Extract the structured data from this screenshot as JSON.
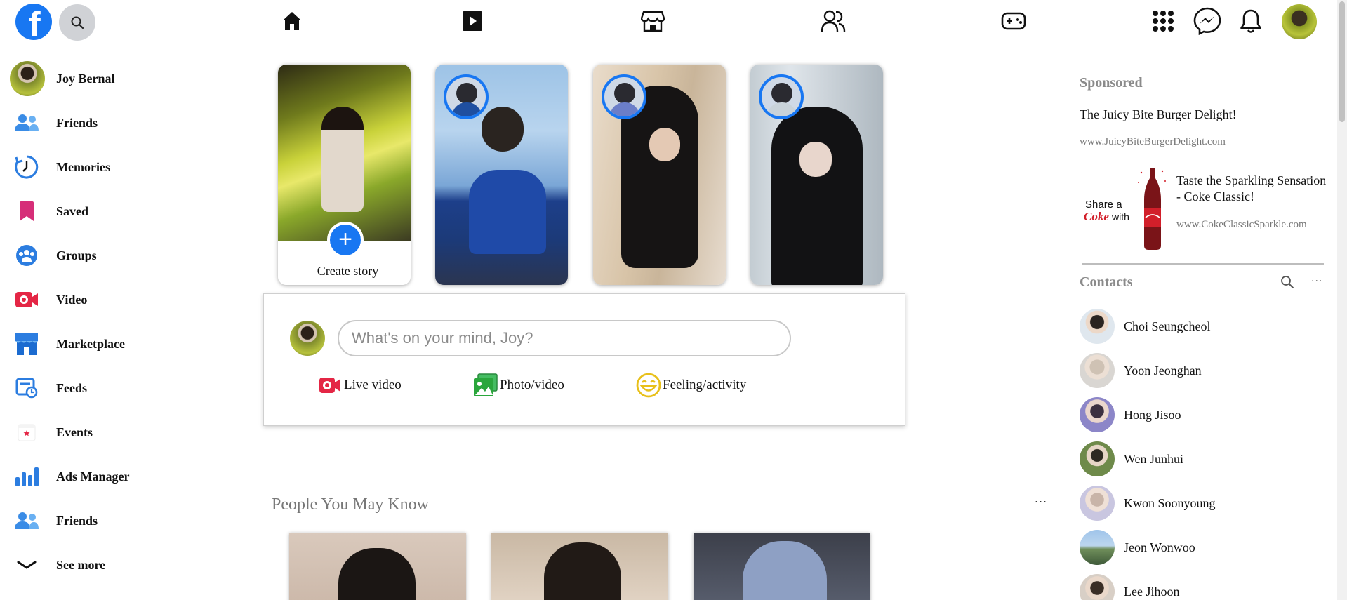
{
  "topbar": {
    "logo_letter": "f",
    "nav": [
      "home-icon",
      "watch-icon",
      "marketplace-icon",
      "groups-icon",
      "gaming-icon"
    ],
    "right": [
      "menu-grid-icon",
      "messenger-icon",
      "notifications-bell-icon",
      "profile-avatar"
    ]
  },
  "sidebar": {
    "items": [
      {
        "label": "Joy Bernal",
        "icon": "profile-avatar"
      },
      {
        "label": "Friends",
        "icon": "friends-icon"
      },
      {
        "label": "Memories",
        "icon": "memories-clock-icon"
      },
      {
        "label": "Saved",
        "icon": "saved-bookmark-icon"
      },
      {
        "label": "Groups",
        "icon": "groups-icon"
      },
      {
        "label": "Video",
        "icon": "video-icon"
      },
      {
        "label": "Marketplace",
        "icon": "marketplace-icon"
      },
      {
        "label": "Feeds",
        "icon": "feeds-icon"
      },
      {
        "label": "Events",
        "icon": "events-calendar-icon"
      },
      {
        "label": "Ads Manager",
        "icon": "ads-manager-chart-icon"
      },
      {
        "label": "Friends",
        "icon": "friends-icon"
      },
      {
        "label": "See more",
        "icon": "chevron-down-icon"
      }
    ]
  },
  "stories": {
    "create_label": "Create story",
    "plus": "+"
  },
  "composer": {
    "placeholder": "What's on your mind, Joy?",
    "actions": [
      {
        "label": "Live video",
        "icon": "live-video-icon",
        "color": "#e42645"
      },
      {
        "label": "Photo/video",
        "icon": "photo-video-icon",
        "color": "#2aa63c"
      },
      {
        "label": "Feeling/activity",
        "icon": "feeling-smiley-icon",
        "color": "#e8c01a"
      }
    ]
  },
  "pymk": {
    "title": "People You May Know",
    "more": "..."
  },
  "sponsored": {
    "title": "Sponsored",
    "ads": [
      {
        "title": "The Juicy Bite Burger Delight!",
        "url": "www.JuicyBiteBurgerDelight.com"
      },
      {
        "title": "Taste the Sparkling Sensation - Coke Classic!",
        "url": "www.CokeClassicSparkle.com",
        "image_text_1": "Share a",
        "image_text_2": "Coke",
        "image_text_3": "with"
      }
    ]
  },
  "contacts": {
    "title": "Contacts",
    "more": "...",
    "people": [
      "Choi Seungcheol",
      "Yoon Jeonghan",
      "Hong Jisoo",
      "Wen Junhui",
      "Kwon Soonyoung",
      "Jeon Wonwoo",
      "Lee Jihoon"
    ]
  },
  "colors": {
    "brand": "#1877f2",
    "muted_heading": "#8a8a8a"
  }
}
